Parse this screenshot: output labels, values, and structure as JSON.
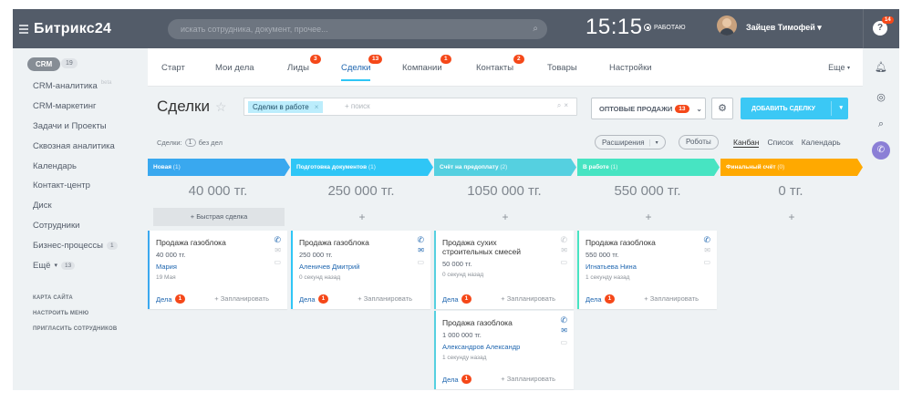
{
  "app": {
    "logo": "Битрикс24",
    "search_placeholder": "искать сотрудника, документ, прочее...",
    "time": "15:15",
    "work_status": "РАБОТАЮ",
    "user_name": "Зайцев Тимофей",
    "help_badge": "14"
  },
  "sidebar": {
    "crm_label": "CRM",
    "crm_count": "19",
    "items": [
      {
        "label": "CRM-аналитика",
        "beta": "beta"
      },
      {
        "label": "CRM-маркетинг"
      },
      {
        "label": "Задачи и Проекты"
      },
      {
        "label": "Сквозная аналитика"
      },
      {
        "label": "Календарь"
      },
      {
        "label": "Контакт-центр"
      },
      {
        "label": "Диск"
      },
      {
        "label": "Сотрудники"
      },
      {
        "label": "Бизнес-процессы",
        "count": "1"
      },
      {
        "label": "Ещё",
        "count": "13"
      }
    ],
    "small": [
      "КАРТА САЙТА",
      "НАСТРОИТЬ МЕНЮ",
      "ПРИГЛАСИТЬ СОТРУДНИКОВ"
    ]
  },
  "tabs": [
    {
      "label": "Старт"
    },
    {
      "label": "Мои дела"
    },
    {
      "label": "Лиды",
      "badge": "3"
    },
    {
      "label": "Сделки",
      "badge": "13"
    },
    {
      "label": "Компании",
      "badge": "1"
    },
    {
      "label": "Контакты",
      "badge": "2"
    },
    {
      "label": "Товары"
    },
    {
      "label": "Настройки"
    }
  ],
  "more_label": "Еще",
  "toolbar": {
    "title": "Сделки",
    "filter_tag": "Сделки в работе",
    "filter_placeholder": "+ поиск",
    "wholesale_label": "ОПТОВЫЕ ПРОДАЖИ",
    "wholesale_badge": "13",
    "add_label": "ДОБАВИТЬ СДЕЛКУ"
  },
  "subbar": {
    "deals_label": "Сделки:",
    "deals_count": "1",
    "deals_suffix": "без дел",
    "extensions": "Расширения",
    "robots": "Роботы",
    "views": [
      "Канбан",
      "Список",
      "Календарь"
    ]
  },
  "colors": {
    "stage_new": "#39a8ef",
    "stage_docs": "#2fc6f6",
    "stage_prepay": "#55d0e0",
    "stage_work": "#47e4c2",
    "stage_final": "#ffa900",
    "badge": "#f54819",
    "link": "#2067b0"
  },
  "columns": [
    {
      "stage": "Новая",
      "count": "(1)",
      "sum": "40 000 тг.",
      "quick": "+ Быстрая сделка",
      "cards": [
        {
          "title": "Продажа газоблока",
          "price": "40 000 тг.",
          "client": "Мария",
          "date": "19 Мая",
          "tasks": "Дела",
          "tasks_badge": "1",
          "plan": "+ Запланировать"
        }
      ]
    },
    {
      "stage": "Подготовка документов",
      "count": "(1)",
      "sum": "250 000 тг.",
      "quick": "+",
      "cards": [
        {
          "title": "Продажа газоблока",
          "price": "250 000 тг.",
          "client": "Аленичев Дмитрий",
          "date": "0 секунд назад",
          "tasks": "Дела",
          "tasks_badge": "1",
          "plan": "+ Запланировать"
        }
      ]
    },
    {
      "stage": "Счёт на предоплату",
      "count": "(2)",
      "sum": "1050 000 тг.",
      "quick": "+",
      "cards": [
        {
          "title": "Продажа сухих строительных смесей",
          "price": "50 000 тг.",
          "client": "",
          "date": "0 секунд назад",
          "tasks": "Дела",
          "tasks_badge": "1",
          "plan": "+ Запланировать"
        },
        {
          "title": "Продажа газоблока",
          "price": "1 000 000 тг.",
          "client": "Александров Александр",
          "date": "1 секунду назад",
          "tasks": "Дела",
          "tasks_badge": "1",
          "plan": "+ Запланировать"
        }
      ]
    },
    {
      "stage": "В работе",
      "count": "(1)",
      "sum": "550 000 тг.",
      "quick": "+",
      "cards": [
        {
          "title": "Продажа газоблока",
          "price": "550 000 тг.",
          "client": "Игнатьева Нина",
          "date": "1 секунду назад",
          "tasks": "Дела",
          "tasks_badge": "1",
          "plan": "+ Запланировать"
        }
      ]
    },
    {
      "stage": "Финальный счёт",
      "count": "(0)",
      "sum": "0 тг.",
      "quick": "+",
      "cards": []
    }
  ]
}
